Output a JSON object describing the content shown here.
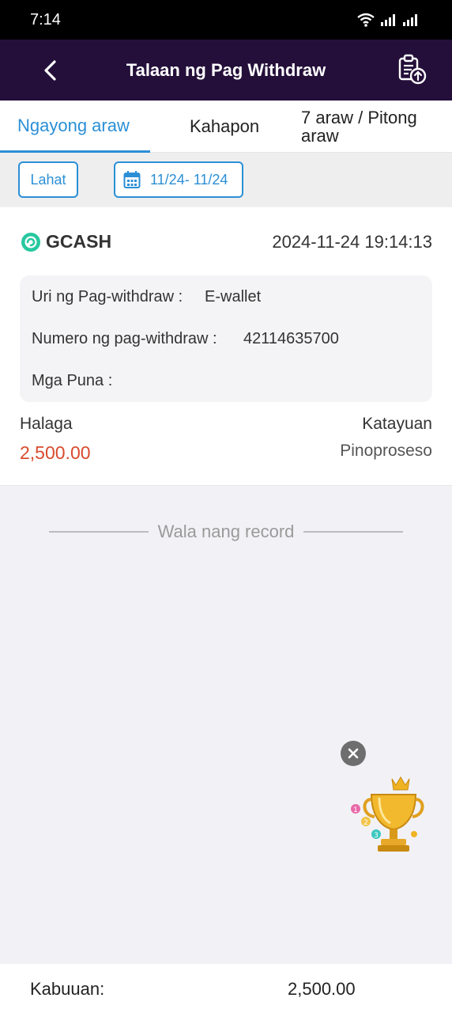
{
  "status_bar": {
    "time": "7:14"
  },
  "header": {
    "title": "Talaan ng Pag Withdraw"
  },
  "tabs": [
    {
      "label": "Ngayong araw",
      "active": true
    },
    {
      "label": "Kahapon",
      "active": false
    },
    {
      "label": "7 araw / Pitong araw",
      "active": false
    }
  ],
  "filters": {
    "all_label": "Lahat",
    "date_range": "11/24- 11/24"
  },
  "record": {
    "brand": "GCASH",
    "datetime": "2024-11-24 19:14:13",
    "type_label": "Uri ng Pag-withdraw :",
    "type_value": "E-wallet",
    "number_label": "Numero ng pag-withdraw :",
    "number_value": "42114635700",
    "remarks_label": "Mga Puna :",
    "remarks_value": "",
    "amount_label": "Halaga",
    "amount_value": "2,500.00",
    "status_label": "Katayuan",
    "status_value": "Pinoproseso"
  },
  "no_more_records": "Wala nang record",
  "footer": {
    "total_label": "Kabuuan:",
    "total_value": "2,500.00"
  },
  "colors": {
    "header_bg": "#240f3a",
    "accent": "#2b8fd6",
    "amount": "#d84a2c"
  },
  "icons": [
    "back-arrow-icon",
    "upload-record-icon",
    "calendar-icon",
    "gcash-logo-icon",
    "close-icon",
    "trophy-icon"
  ]
}
